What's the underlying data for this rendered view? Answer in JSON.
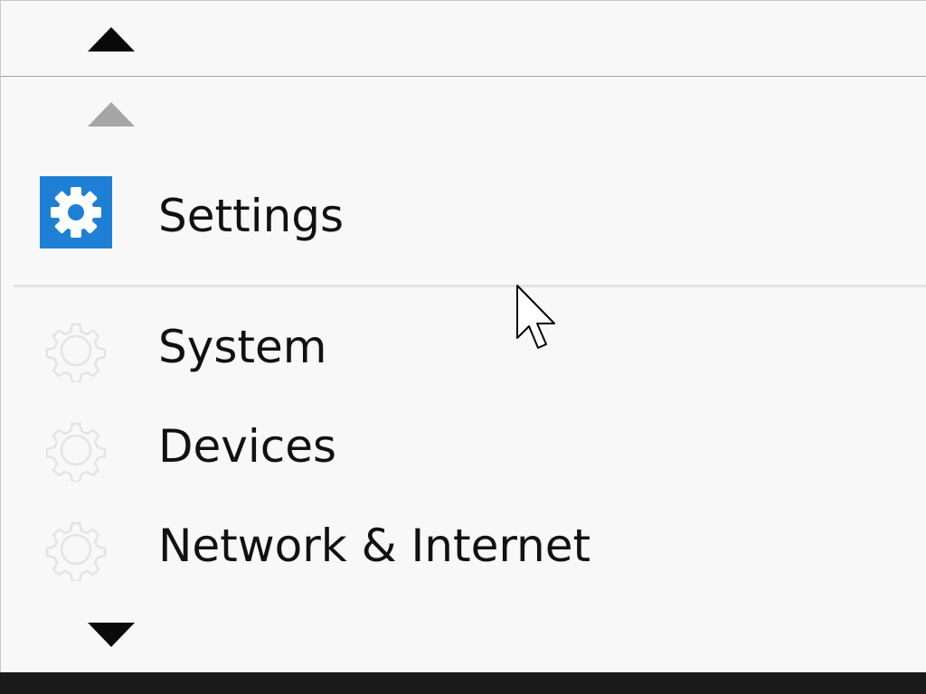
{
  "header": {
    "title": "Settings",
    "accent_color": "#1f7fd4",
    "icon": "gear-icon"
  },
  "menu": {
    "items": [
      {
        "label": "System",
        "icon": "gear-icon"
      },
      {
        "label": "Devices",
        "icon": "gear-icon"
      },
      {
        "label": "Network & Internet",
        "icon": "gear-icon"
      }
    ]
  },
  "controls": {
    "scroll_up_icon": "triangle-up-icon",
    "page_up_icon": "triangle-up-icon",
    "scroll_down_icon": "triangle-down-icon"
  },
  "taskbar_color": "#1a1a1a"
}
